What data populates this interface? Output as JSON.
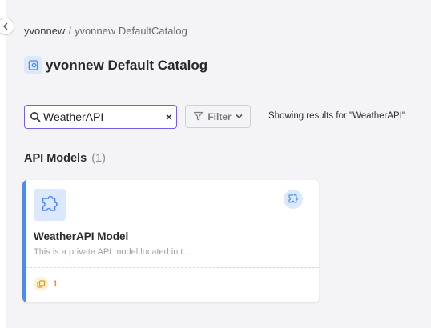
{
  "breadcrumb": {
    "first": "yvonnew",
    "separator": "/",
    "second": "yvonnew DefaultCatalog"
  },
  "page": {
    "title": "yvonnew Default Catalog",
    "icon": "catalog-icon"
  },
  "search": {
    "value": "WeatherAPI",
    "clear_label": "×"
  },
  "filter": {
    "label": "Filter"
  },
  "results": {
    "text": "Showing results for \"WeatherAPI\""
  },
  "section": {
    "title": "API Models",
    "count": "(1)"
  },
  "cards": [
    {
      "title": "WeatherAPI Model",
      "description": "This is a private API model located in t...",
      "version_count": "1",
      "icon": "puzzle-icon",
      "accent_color": "#4a8cf0"
    }
  ],
  "colors": {
    "accent": "#7a5ce0",
    "card_accent": "#4a8cf0",
    "version": "#d8a11c"
  }
}
